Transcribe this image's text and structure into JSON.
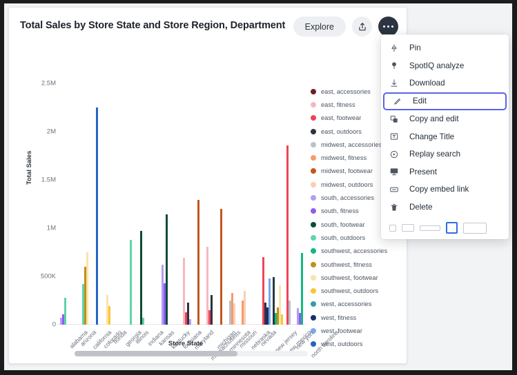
{
  "card": {
    "title": "Total Sales by Store State and Store Region, Department",
    "explore_label": "Explore",
    "share_icon": "share-upload-icon",
    "more_icon": "more-horizontal-icon"
  },
  "chart_data": {
    "type": "bar",
    "title": "Total Sales by Store State and Store Region, Department",
    "xlabel": "Store State",
    "ylabel": "Total Sales",
    "ylim": [
      0,
      2500000
    ],
    "yticks": [
      0,
      500000,
      1000000,
      1500000,
      2000000,
      2500000
    ],
    "ytick_labels": [
      "0",
      "500K",
      "1M",
      "1.5M",
      "2M",
      "2.5M"
    ],
    "grid": false,
    "legend_position": "right",
    "categories": [
      "alabama",
      "arizona",
      "california",
      "colorado",
      "florida",
      "georgia",
      "illinois",
      "indiana",
      "kansas",
      "kentucky",
      "louisiana",
      "maryland",
      "massachusetts",
      "michigan",
      "minnesota",
      "missouri",
      "nebraska",
      "nevada",
      "new jersey",
      "new mexico",
      "new york",
      "north carolina"
    ],
    "series": [
      {
        "name": "east, accessories",
        "color": "#6e1f28",
        "values": [
          0,
          0,
          0,
          0,
          0,
          0,
          0,
          0,
          0,
          0,
          0,
          0,
          0,
          0,
          0,
          0,
          0,
          0,
          0,
          0,
          0,
          0
        ]
      },
      {
        "name": "east, fitness",
        "color": "#f6b7c0",
        "values": [
          0,
          0,
          0,
          0,
          0,
          0,
          0,
          0,
          0,
          0,
          0,
          690000,
          0,
          810000,
          0,
          0,
          0,
          0,
          0,
          0,
          0,
          0
        ]
      },
      {
        "name": "east, footwear",
        "color": "#ef4458",
        "values": [
          0,
          0,
          0,
          0,
          0,
          0,
          0,
          0,
          0,
          0,
          0,
          130000,
          0,
          150000,
          0,
          0,
          0,
          0,
          700000,
          0,
          1860000,
          0
        ]
      },
      {
        "name": "east, outdoors",
        "color": "#2b3440",
        "values": [
          0,
          0,
          0,
          0,
          0,
          0,
          0,
          0,
          0,
          0,
          0,
          230000,
          0,
          310000,
          0,
          0,
          0,
          0,
          230000,
          490000,
          0,
          0
        ]
      },
      {
        "name": "midwest, accessories",
        "color": "#b9c2cc",
        "values": [
          0,
          0,
          0,
          0,
          0,
          0,
          0,
          0,
          0,
          0,
          0,
          0,
          0,
          0,
          0,
          250000,
          0,
          0,
          0,
          0,
          250000,
          0
        ]
      },
      {
        "name": "midwest, fitness",
        "color": "#f79a6b",
        "values": [
          0,
          0,
          0,
          0,
          0,
          0,
          0,
          0,
          0,
          0,
          0,
          0,
          0,
          0,
          0,
          330000,
          250000,
          0,
          0,
          0,
          0,
          0
        ]
      },
      {
        "name": "midwest, footwear",
        "color": "#c4561f",
        "values": [
          0,
          0,
          0,
          0,
          0,
          0,
          0,
          0,
          0,
          0,
          0,
          0,
          1290000,
          0,
          1200000,
          0,
          0,
          0,
          0,
          0,
          0,
          0
        ]
      },
      {
        "name": "midwest, outdoors",
        "color": "#fbcdb4",
        "values": [
          0,
          0,
          0,
          0,
          0,
          0,
          0,
          0,
          0,
          0,
          0,
          0,
          0,
          0,
          0,
          220000,
          350000,
          0,
          0,
          0,
          0,
          0
        ]
      },
      {
        "name": "south, accessories",
        "color": "#b49cf5",
        "values": [
          70000,
          0,
          0,
          0,
          0,
          0,
          0,
          0,
          0,
          620000,
          0,
          60000,
          0,
          0,
          0,
          0,
          0,
          0,
          0,
          0,
          0,
          170000
        ]
      },
      {
        "name": "south, fitness",
        "color": "#8b5cf6",
        "values": [
          110000,
          0,
          0,
          0,
          0,
          0,
          0,
          0,
          0,
          430000,
          0,
          0,
          0,
          0,
          0,
          0,
          0,
          0,
          0,
          0,
          0,
          120000
        ]
      },
      {
        "name": "south, footwear",
        "color": "#0d4d34",
        "values": [
          0,
          0,
          0,
          0,
          0,
          0,
          0,
          970000,
          0,
          1140000,
          0,
          0,
          0,
          0,
          0,
          0,
          0,
          0,
          0,
          0,
          0,
          0
        ]
      },
      {
        "name": "south, outdoors",
        "color": "#5fd4a8",
        "values": [
          280000,
          0,
          420000,
          0,
          0,
          0,
          880000,
          70000,
          0,
          0,
          0,
          0,
          0,
          0,
          0,
          0,
          0,
          0,
          0,
          0,
          0,
          0
        ]
      },
      {
        "name": "southwest, accessories",
        "color": "#10b981",
        "values": [
          0,
          0,
          0,
          0,
          0,
          0,
          0,
          0,
          0,
          0,
          0,
          0,
          0,
          0,
          0,
          0,
          0,
          0,
          0,
          120000,
          0,
          740000
        ]
      },
      {
        "name": "southwest, fitness",
        "color": "#c09018",
        "values": [
          0,
          0,
          600000,
          0,
          0,
          0,
          0,
          0,
          0,
          0,
          0,
          0,
          0,
          0,
          0,
          0,
          0,
          0,
          0,
          180000,
          0,
          0
        ]
      },
      {
        "name": "southwest, footwear",
        "color": "#fae3a8",
        "values": [
          0,
          0,
          750000,
          0,
          310000,
          0,
          0,
          0,
          0,
          0,
          0,
          0,
          0,
          0,
          0,
          0,
          0,
          0,
          0,
          410000,
          0,
          0
        ]
      },
      {
        "name": "southwest, outdoors",
        "color": "#f9c638",
        "values": [
          0,
          0,
          0,
          0,
          190000,
          0,
          0,
          0,
          0,
          0,
          0,
          0,
          0,
          0,
          0,
          0,
          0,
          0,
          0,
          110000,
          0,
          0
        ]
      },
      {
        "name": "west, accessories",
        "color": "#2f9fa6",
        "values": [
          0,
          0,
          0,
          0,
          0,
          0,
          0,
          0,
          0,
          0,
          0,
          0,
          0,
          0,
          0,
          0,
          0,
          0,
          0,
          0,
          0,
          0
        ]
      },
      {
        "name": "west, fitness",
        "color": "#16306b",
        "values": [
          0,
          0,
          0,
          0,
          0,
          0,
          0,
          0,
          0,
          0,
          0,
          0,
          0,
          0,
          0,
          0,
          0,
          0,
          180000,
          0,
          0,
          0
        ]
      },
      {
        "name": "west, footwear",
        "color": "#7aa6f0",
        "values": [
          0,
          0,
          0,
          0,
          0,
          0,
          0,
          0,
          0,
          0,
          0,
          0,
          0,
          0,
          0,
          0,
          0,
          0,
          480000,
          0,
          0,
          0
        ]
      },
      {
        "name": "west, outdoors",
        "color": "#2563c4",
        "values": [
          0,
          0,
          0,
          2250000,
          0,
          0,
          0,
          0,
          0,
          0,
          0,
          0,
          0,
          0,
          0,
          0,
          0,
          0,
          0,
          0,
          0,
          0
        ]
      }
    ]
  },
  "legend": [
    {
      "label": "east, accessories",
      "color": "#6e1f28"
    },
    {
      "label": "east, fitness",
      "color": "#f6b7c0"
    },
    {
      "label": "east, footwear",
      "color": "#ef4458"
    },
    {
      "label": "east, outdoors",
      "color": "#2b3440"
    },
    {
      "label": "midwest, accessories",
      "color": "#b9c2cc"
    },
    {
      "label": "midwest, fitness",
      "color": "#f79a6b"
    },
    {
      "label": "midwest, footwear",
      "color": "#c4561f"
    },
    {
      "label": "midwest, outdoors",
      "color": "#fbcdb4"
    },
    {
      "label": "south, accessories",
      "color": "#b49cf5"
    },
    {
      "label": "south, fitness",
      "color": "#8b5cf6"
    },
    {
      "label": "south, footwear",
      "color": "#0d4d34"
    },
    {
      "label": "south, outdoors",
      "color": "#5fd4a8"
    },
    {
      "label": "southwest, accessories",
      "color": "#10b981"
    },
    {
      "label": "southwest, fitness",
      "color": "#c09018"
    },
    {
      "label": "southwest, footwear",
      "color": "#fae3a8"
    },
    {
      "label": "southwest, outdoors",
      "color": "#f9c638"
    },
    {
      "label": "west, accessories",
      "color": "#2f9fa6"
    },
    {
      "label": "west, fitness",
      "color": "#16306b"
    },
    {
      "label": "west, footwear",
      "color": "#7aa6f0"
    },
    {
      "label": "west, outdoors",
      "color": "#2563c4"
    }
  ],
  "menu": {
    "items": [
      {
        "label": "Pin",
        "icon": "pin-icon",
        "selected": false
      },
      {
        "label": "SpotIQ analyze",
        "icon": "spotiq-icon",
        "selected": false
      },
      {
        "label": "Download",
        "icon": "download-icon",
        "selected": false
      },
      {
        "label": "Edit",
        "icon": "pencil-icon",
        "selected": true
      },
      {
        "label": "Copy and edit",
        "icon": "copy-icon",
        "selected": false
      },
      {
        "label": "Change Title",
        "icon": "text-box-icon",
        "selected": false
      },
      {
        "label": "Replay search",
        "icon": "replay-icon",
        "selected": false
      },
      {
        "label": "Present",
        "icon": "present-icon",
        "selected": false
      },
      {
        "label": "Copy embed link",
        "icon": "embed-link-icon",
        "selected": false
      },
      {
        "label": "Delete",
        "icon": "trash-icon",
        "selected": false
      }
    ],
    "size_options": [
      {
        "name": "size-small",
        "active": false
      },
      {
        "name": "size-medium",
        "active": false
      },
      {
        "name": "size-wide",
        "active": false
      },
      {
        "name": "size-square",
        "active": true
      },
      {
        "name": "size-extra-wide",
        "active": false
      }
    ]
  },
  "scrollbar": {
    "name": "horizontal-scrollbar"
  }
}
